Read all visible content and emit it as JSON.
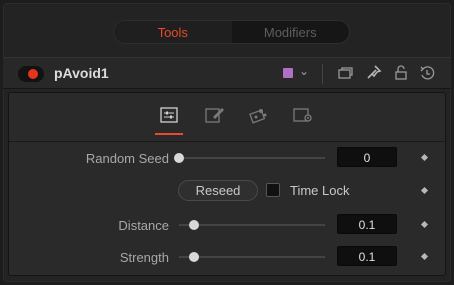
{
  "tabs": [
    {
      "label": "Tools",
      "active": true
    },
    {
      "label": "Modifiers",
      "active": false
    }
  ],
  "tool": {
    "name": "pAvoid1",
    "enabled_color": "#e8341c",
    "color_swatch": "#b070c0",
    "icons": [
      "chevron-down-icon",
      "view-icon",
      "pin-icon",
      "lock-icon",
      "reset-icon"
    ]
  },
  "inspector_tabs": [
    "controls-icon",
    "edit-icon",
    "network-icon",
    "settings-icon"
  ],
  "params": {
    "random_seed": {
      "label": "Random Seed",
      "value": "0",
      "slider_fraction": 0.0
    },
    "reseed": {
      "label": "Reseed"
    },
    "time_lock": {
      "label": "Time Lock",
      "checked": false
    },
    "distance": {
      "label": "Distance",
      "value": "0.1",
      "slider_fraction": 0.1
    },
    "strength": {
      "label": "Strength",
      "value": "0.1",
      "slider_fraction": 0.1
    }
  },
  "colors": {
    "accent": "#e8492f"
  }
}
